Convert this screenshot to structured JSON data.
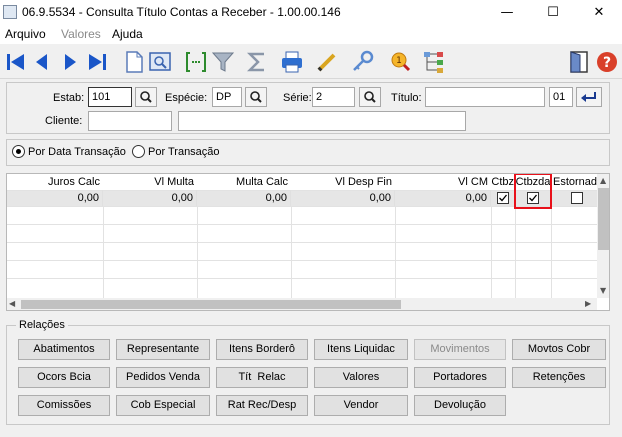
{
  "window": {
    "title": "06.9.5534 - Consulta Título Contas a Receber - 1.00.00.146",
    "minimize": "—",
    "maximize": "☐",
    "close": "✕"
  },
  "menu": [
    "Arquivo",
    "Valores",
    "Ajuda"
  ],
  "filters": {
    "estab_label": "Estab:",
    "estab_value": "101",
    "especie_label": "Espécie:",
    "especie_value": "DP",
    "serie_label": "Série:",
    "serie_value": "2",
    "titulo_label": "Título:",
    "titulo_value": "",
    "parcela_value": "01",
    "cliente_label": "Cliente:",
    "cliente_code": "",
    "cliente_name": ""
  },
  "options": {
    "by_date": "Por Data Transação",
    "by_transaction": "Por Transação",
    "selected": "by_date"
  },
  "grid": {
    "columns": [
      "Juros Calc",
      "Vl Multa",
      "Multa Calc",
      "Vl Desp Fin",
      "Vl CM",
      "Ctbz",
      "Ctbzda",
      "Estornad"
    ],
    "rows": [
      {
        "juros_calc": "0,00",
        "vl_multa": "0,00",
        "multa_calc": "0,00",
        "vl_desp_fin": "0,00",
        "vl_cm": "0,00",
        "ctbz": true,
        "ctbzda": true,
        "estornado": false
      }
    ]
  },
  "relations": {
    "title": "Relações",
    "buttons": [
      [
        {
          "label": "Abatimentos",
          "enabled": true
        },
        {
          "label": "Representante",
          "enabled": true
        },
        {
          "label": "Itens Borderô",
          "enabled": true
        },
        {
          "label": "Itens Liquidac",
          "enabled": true
        },
        {
          "label": "Movimentos",
          "enabled": false
        },
        {
          "label": "Movtos Cobr",
          "enabled": true
        }
      ],
      [
        {
          "label": "Ocors Bcia",
          "enabled": true
        },
        {
          "label": "Pedidos Venda",
          "enabled": true
        },
        {
          "label": "Tít  Relac",
          "enabled": true
        },
        {
          "label": "Valores",
          "enabled": true
        },
        {
          "label": "Portadores",
          "enabled": true
        },
        {
          "label": "Retenções",
          "enabled": true
        }
      ],
      [
        {
          "label": "Comissões",
          "enabled": true
        },
        {
          "label": "Cob Especial",
          "enabled": true
        },
        {
          "label": "Rat Rec/Desp",
          "enabled": true
        },
        {
          "label": "Vendor",
          "enabled": true
        },
        {
          "label": "Devolução",
          "enabled": true
        }
      ]
    ]
  },
  "colors": {
    "highlight": "#e8101a",
    "nav_blue": "#1a56c8",
    "help_red": "#d9402a"
  }
}
